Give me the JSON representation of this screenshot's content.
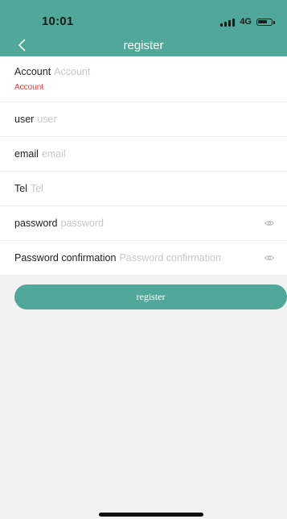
{
  "status_bar": {
    "time": "10:01",
    "network": "4G",
    "battery_level": 0.7
  },
  "nav": {
    "title": "register",
    "back_icon": "chevron-left-icon"
  },
  "form": {
    "account": {
      "label": "Account",
      "placeholder": "Account",
      "error": "Account"
    },
    "user": {
      "label": "user",
      "placeholder": "user"
    },
    "email": {
      "label": "email",
      "placeholder": "email"
    },
    "tel": {
      "label": "Tel",
      "placeholder": "Tel"
    },
    "password": {
      "label": "password",
      "placeholder": "password",
      "toggle_icon": "eye-icon"
    },
    "password_confirmation": {
      "label": "Password confirmation",
      "placeholder": "Password confirmation",
      "toggle_icon": "eye-icon"
    }
  },
  "register_button": {
    "label": "register"
  },
  "colors": {
    "accent": "#4fa89a",
    "error": "#e03b3b",
    "background": "#f2f2f2"
  }
}
